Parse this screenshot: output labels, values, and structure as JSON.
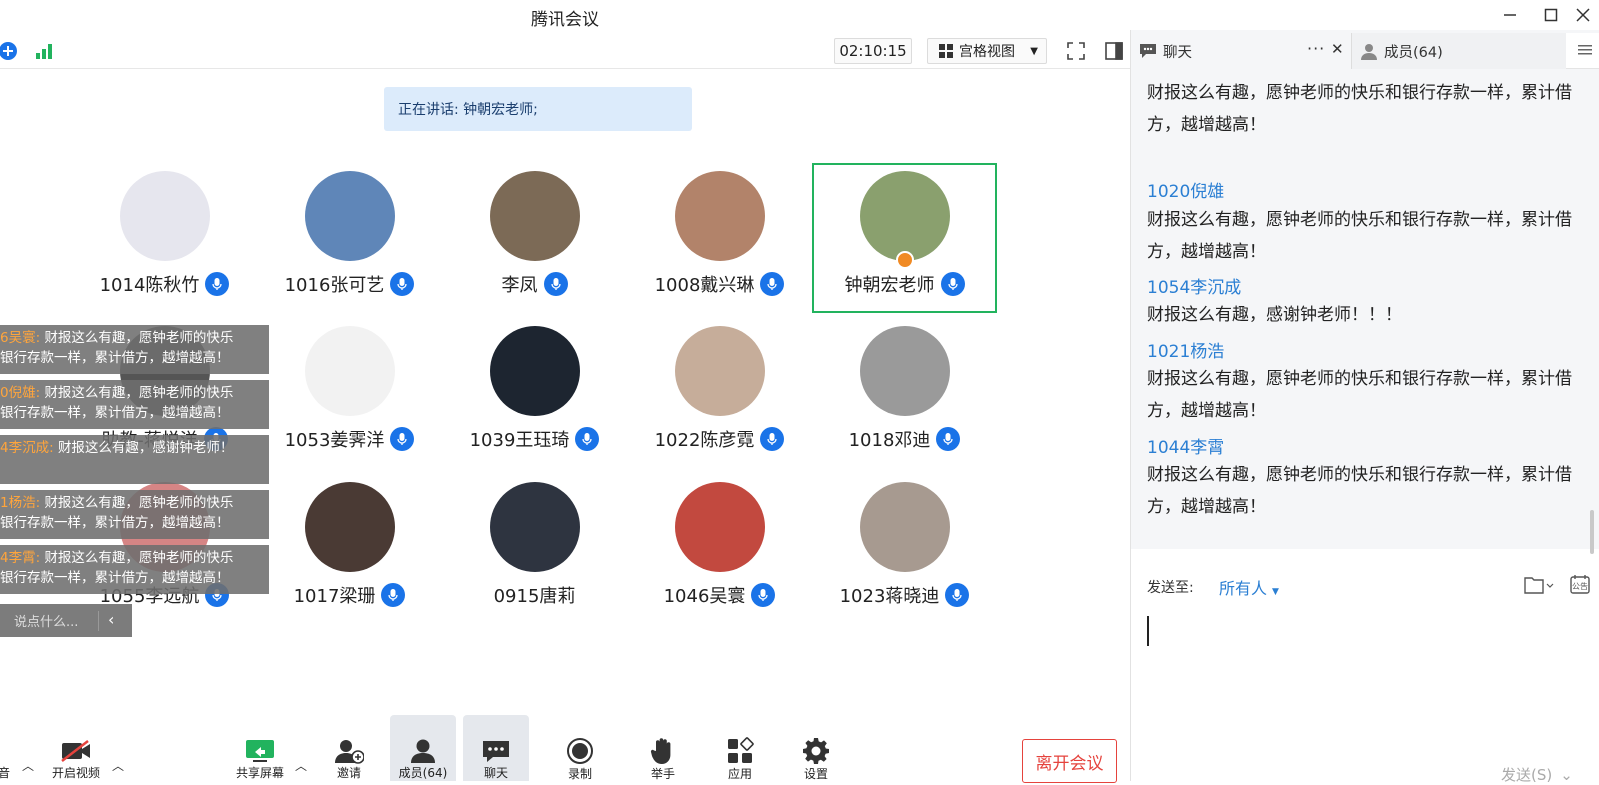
{
  "app": {
    "title": "腾讯会议"
  },
  "toolbar": {
    "timer": "02:10:15",
    "view_mode": "宫格视图"
  },
  "speaking": {
    "text": "正在讲话: 钟朝宏老师;"
  },
  "participants": [
    {
      "name": "1014陈秋竹",
      "bg": "#e6e6ee"
    },
    {
      "name": "1016张可艺",
      "bg": "#5f86b8"
    },
    {
      "name": "李凤",
      "bg": "#7c6a56"
    },
    {
      "name": "1008戴兴琳",
      "bg": "#b2836a"
    },
    {
      "name": "钟朝宏老师",
      "bg": "#8aa06e"
    },
    {
      "name": "助教-蒋悦洋",
      "bg": "#555555"
    },
    {
      "name": "1053姜霁洋",
      "bg": "#f2f2f2"
    },
    {
      "name": "1039王珏琦",
      "bg": "#1d2530"
    },
    {
      "name": "1022陈彦霓",
      "bg": "#c6ad9a"
    },
    {
      "name": "1018邓迪",
      "bg": "#9a9a9a"
    },
    {
      "name": "1055李远航",
      "bg": "#d68585"
    },
    {
      "name": "1017梁珊",
      "bg": "#4a3a34"
    },
    {
      "name": "0915唐莉",
      "bg": "#2e3440"
    },
    {
      "name": "1046吴寰",
      "bg": "#c2493f"
    },
    {
      "name": "1023蒋晓迪",
      "bg": "#a79a90"
    }
  ],
  "danmaku": [
    {
      "who": "6吴寰:",
      "line1": "财报这么有趣，愿钟老师的快乐",
      "line2": "银行存款一样，累计借方，越增越高！"
    },
    {
      "who": "0倪雄:",
      "line1": "财报这么有趣，愿钟老师的快乐",
      "line2": "银行存款一样，累计借方，越增越高！"
    },
    {
      "who": "4李沉成:",
      "line1": "财报这么有趣，感谢钟老师！",
      "line2": ""
    },
    {
      "who": "1杨浩:",
      "line1": "财报这么有趣，愿钟老师的快乐",
      "line2": "银行存款一样，累计借方，越增越高！"
    },
    {
      "who": "4李霄:",
      "line1": "财报这么有趣，愿钟老师的快乐",
      "line2": "银行存款一样，累计借方，越增越高！"
    }
  ],
  "say_placeholder": "说点什么...",
  "bottom_bar": {
    "audio_label": "音",
    "video_label": "开启视频",
    "share_label": "共享屏幕",
    "invite_label": "邀请",
    "members_label": "成员(64)",
    "chat_label": "聊天",
    "record_label": "录制",
    "raise_hand_label": "举手",
    "apps_label": "应用",
    "settings_label": "设置",
    "leave_label": "离开会议"
  },
  "chat": {
    "tab_chat": "聊天",
    "tab_members": "成员(64)",
    "messages": [
      {
        "name": "",
        "text": "财报这么有趣，愿钟老师的快乐和银行存款一样，累计借方，越增越高！"
      },
      {
        "name": "1020倪雄",
        "text": "财报这么有趣，愿钟老师的快乐和银行存款一样，累计借方，越增越高！"
      },
      {
        "name": "1054李沉成",
        "text": "财报这么有趣，感谢钟老师！！！"
      },
      {
        "name": "1021杨浩",
        "text": "财报这么有趣，愿钟老师的快乐和银行存款一样，累计借方，越增越高！"
      },
      {
        "name": "1044李霄",
        "text": "财报这么有趣，愿钟老师的快乐和银行存款一样，累计借方，越增越高！"
      }
    ],
    "send_to_label": "发送至:",
    "send_to_value": "所有人",
    "send_button": "发送(S)"
  }
}
